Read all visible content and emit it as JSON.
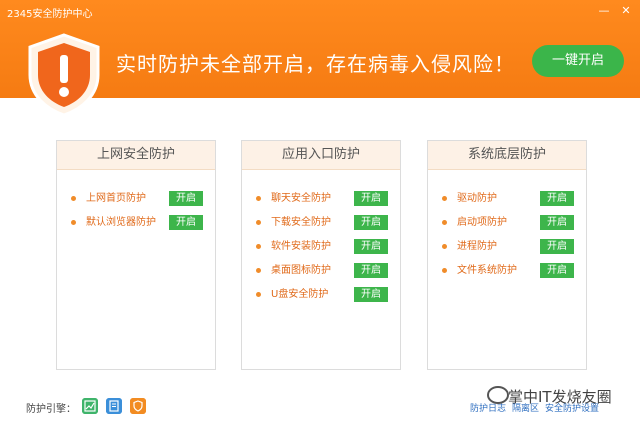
{
  "app": {
    "title": "2345安全防护中心",
    "minimize": "—",
    "close": "✕"
  },
  "header": {
    "warning": "实时防护未全部开启，存在病毒入侵风险！",
    "enable_all": "一键开启",
    "colors": {
      "header": "#f57b12",
      "accent_green": "#3bb54a"
    }
  },
  "panels": [
    {
      "title": "上网安全防护",
      "items": [
        {
          "label": "上网首页防护",
          "action": "开启"
        },
        {
          "label": "默认浏览器防护",
          "action": "开启"
        }
      ]
    },
    {
      "title": "应用入口防护",
      "items": [
        {
          "label": "聊天安全防护",
          "action": "开启"
        },
        {
          "label": "下载安全防护",
          "action": "开启"
        },
        {
          "label": "软件安装防护",
          "action": "开启"
        },
        {
          "label": "桌面图标防护",
          "action": "开启"
        },
        {
          "label": "U盘安全防护",
          "action": "开启"
        }
      ]
    },
    {
      "title": "系统底层防护",
      "items": [
        {
          "label": "驱动防护",
          "action": "开启"
        },
        {
          "label": "启动项防护",
          "action": "开启"
        },
        {
          "label": "进程防护",
          "action": "开启"
        },
        {
          "label": "文件系统防护",
          "action": "开启"
        }
      ]
    }
  ],
  "footer": {
    "engine_label": "防护引擎：",
    "engine_icons": [
      "chart-icon",
      "document-icon",
      "shield-icon"
    ],
    "links": [
      "防护日志",
      "隔离区",
      "安全防护设置"
    ]
  },
  "watermark": "掌中IT发烧友圈"
}
